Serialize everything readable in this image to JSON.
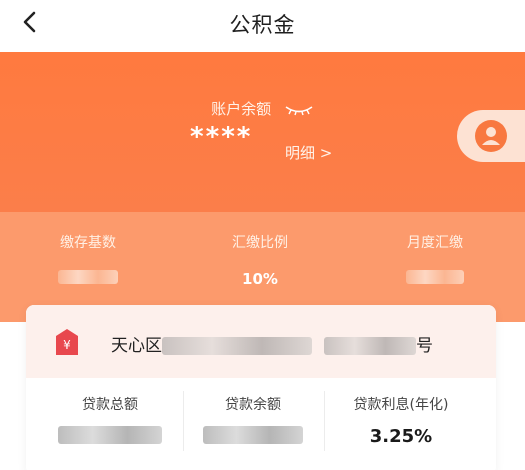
{
  "nav": {
    "title": "公积金"
  },
  "balance": {
    "label": "账户余额",
    "value": "****",
    "detail_link": "明细 >"
  },
  "stats": [
    {
      "label": "缴存基数",
      "value": ""
    },
    {
      "label": "汇缴比例",
      "value": "10%"
    },
    {
      "label": "月度汇缴",
      "value": ""
    }
  ],
  "account_card": {
    "address_prefix": "天心区",
    "address_suffix": "号",
    "items": [
      {
        "label": "贷款总额",
        "value": ""
      },
      {
        "label": "贷款余额",
        "value": ""
      },
      {
        "label": "贷款利息(年化)",
        "value": "3.25%"
      }
    ]
  },
  "colors": {
    "accent": "#ff7a3f",
    "strip": "#fc9a6c",
    "card_head": "#fdf0ec",
    "icon_red": "#e8484e"
  }
}
